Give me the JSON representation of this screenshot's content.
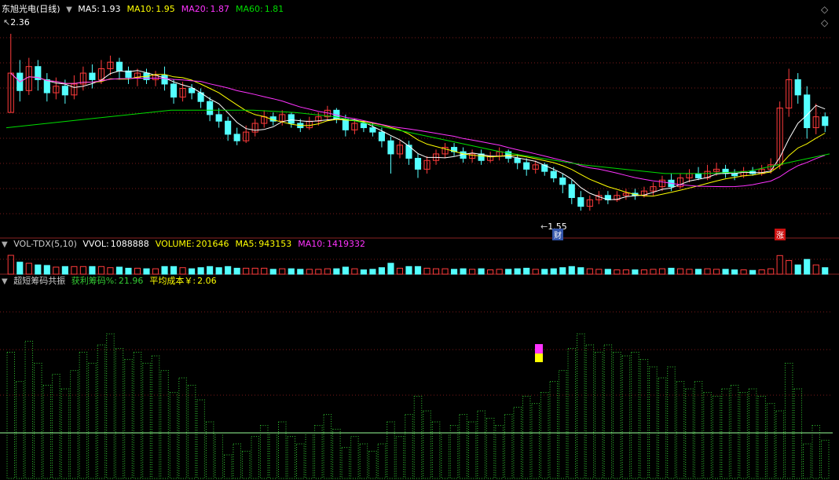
{
  "colors": {
    "up": "#ff3b3b",
    "down": "#54ffff",
    "ma5": "#ffffff",
    "ma10": "#ffff00",
    "ma20": "#ff33ff",
    "ma60": "#00dd00",
    "grid": "#7a1a1a",
    "chip": "#33cc33",
    "chip_light": "#99ff99"
  },
  "price_panel": {
    "title": "东旭光电(日线)",
    "indicators": [
      {
        "label": "MA5:",
        "value": "1.93",
        "color": "#ffffff"
      },
      {
        "label": "MA10:",
        "value": "1.95",
        "color": "#ffff00"
      },
      {
        "label": "MA20:",
        "value": "1.87",
        "color": "#ff33ff"
      },
      {
        "label": "MA60:",
        "value": "1.81",
        "color": "#00dd00"
      }
    ],
    "high_label": "2.36",
    "low_label": "1.55",
    "badge_cai": "财",
    "badge_zhang": "涨"
  },
  "volume_panel": {
    "title": "VOL-TDX(5,10)",
    "indicators": [
      {
        "label": "VVOL:",
        "value": "1088888",
        "color": "#ffffff"
      },
      {
        "label": "VOLUME:",
        "value": "201646",
        "color": "#ffff00"
      },
      {
        "label": "MA5:",
        "value": "943153",
        "color": "#ffff00"
      },
      {
        "label": "MA10:",
        "value": "1419332",
        "color": "#ff33ff"
      }
    ]
  },
  "chip_panel": {
    "title": "超短筹码共振",
    "indicators": [
      {
        "label": "获利筹码%:",
        "value": "21.96",
        "color": "#33cc33"
      },
      {
        "label": "平均成本￥:",
        "value": "2.06",
        "color": "#ffff00"
      }
    ]
  },
  "chart_data": {
    "type": "candlestick",
    "price_range": [
      1.45,
      2.45
    ],
    "candles": [
      [
        2.0,
        2.18,
        2.0,
        2.36
      ],
      [
        2.18,
        2.1,
        2.05,
        2.24
      ],
      [
        2.1,
        2.21,
        2.08,
        2.25
      ],
      [
        2.21,
        2.15,
        2.1,
        2.24
      ],
      [
        2.15,
        2.09,
        2.05,
        2.18
      ],
      [
        2.09,
        2.12,
        2.06,
        2.16
      ],
      [
        2.12,
        2.08,
        2.04,
        2.15
      ],
      [
        2.08,
        2.13,
        2.06,
        2.17
      ],
      [
        2.13,
        2.18,
        2.1,
        2.21
      ],
      [
        2.18,
        2.15,
        2.11,
        2.22
      ],
      [
        2.15,
        2.2,
        2.13,
        2.24
      ],
      [
        2.2,
        2.23,
        2.17,
        2.26
      ],
      [
        2.23,
        2.19,
        2.15,
        2.25
      ],
      [
        2.19,
        2.16,
        2.13,
        2.21
      ],
      [
        2.16,
        2.18,
        2.12,
        2.2
      ],
      [
        2.18,
        2.15,
        2.13,
        2.2
      ],
      [
        2.15,
        2.17,
        2.12,
        2.19
      ],
      [
        2.17,
        2.13,
        2.1,
        2.21
      ],
      [
        2.13,
        2.07,
        2.04,
        2.15
      ],
      [
        2.07,
        2.11,
        2.05,
        2.14
      ],
      [
        2.11,
        2.09,
        2.06,
        2.13
      ],
      [
        2.09,
        2.05,
        2.02,
        2.11
      ],
      [
        2.05,
        1.99,
        1.96,
        2.07
      ],
      [
        1.99,
        1.96,
        1.93,
        2.02
      ],
      [
        1.96,
        1.9,
        1.87,
        1.98
      ],
      [
        1.9,
        1.87,
        1.85,
        1.93
      ],
      [
        1.87,
        1.91,
        1.86,
        1.94
      ],
      [
        1.91,
        1.95,
        1.89,
        1.97
      ],
      [
        1.95,
        1.98,
        1.93,
        2.01
      ],
      [
        1.98,
        1.96,
        1.94,
        2.0
      ],
      [
        1.96,
        1.99,
        1.94,
        2.01
      ],
      [
        1.99,
        1.95,
        1.93,
        2.0
      ],
      [
        1.95,
        1.93,
        1.91,
        1.97
      ],
      [
        1.93,
        1.96,
        1.92,
        1.98
      ],
      [
        1.96,
        1.98,
        1.94,
        2.0
      ],
      [
        1.98,
        2.01,
        1.96,
        2.03
      ],
      [
        2.01,
        1.97,
        1.95,
        2.02
      ],
      [
        1.97,
        1.92,
        1.89,
        1.99
      ],
      [
        1.92,
        1.95,
        1.9,
        1.97
      ],
      [
        1.95,
        1.93,
        1.91,
        1.96
      ],
      [
        1.93,
        1.91,
        1.89,
        1.95
      ],
      [
        1.91,
        1.87,
        1.84,
        1.93
      ],
      [
        1.87,
        1.81,
        1.72,
        1.89
      ],
      [
        1.81,
        1.85,
        1.79,
        1.87
      ],
      [
        1.85,
        1.79,
        1.76,
        1.87
      ],
      [
        1.79,
        1.74,
        1.7,
        1.81
      ],
      [
        1.74,
        1.78,
        1.72,
        1.8
      ],
      [
        1.78,
        1.81,
        1.76,
        1.83
      ],
      [
        1.81,
        1.84,
        1.79,
        1.86
      ],
      [
        1.84,
        1.82,
        1.8,
        1.86
      ],
      [
        1.82,
        1.79,
        1.77,
        1.84
      ],
      [
        1.79,
        1.81,
        1.77,
        1.83
      ],
      [
        1.81,
        1.78,
        1.76,
        1.83
      ],
      [
        1.78,
        1.8,
        1.77,
        1.82
      ],
      [
        1.8,
        1.82,
        1.78,
        1.84
      ],
      [
        1.82,
        1.79,
        1.77,
        1.83
      ],
      [
        1.79,
        1.77,
        1.74,
        1.81
      ],
      [
        1.77,
        1.74,
        1.71,
        1.79
      ],
      [
        1.74,
        1.76,
        1.72,
        1.78
      ],
      [
        1.76,
        1.73,
        1.71,
        1.77
      ],
      [
        1.73,
        1.7,
        1.68,
        1.75
      ],
      [
        1.7,
        1.67,
        1.63,
        1.72
      ],
      [
        1.67,
        1.61,
        1.58,
        1.69
      ],
      [
        1.61,
        1.57,
        1.55,
        1.64
      ],
      [
        1.57,
        1.6,
        1.55,
        1.62
      ],
      [
        1.6,
        1.62,
        1.58,
        1.64
      ],
      [
        1.62,
        1.6,
        1.58,
        1.64
      ],
      [
        1.6,
        1.62,
        1.59,
        1.64
      ],
      [
        1.62,
        1.63,
        1.6,
        1.65
      ],
      [
        1.63,
        1.62,
        1.6,
        1.65
      ],
      [
        1.62,
        1.64,
        1.61,
        1.66
      ],
      [
        1.64,
        1.66,
        1.62,
        1.68
      ],
      [
        1.66,
        1.69,
        1.64,
        1.71
      ],
      [
        1.69,
        1.66,
        1.64,
        1.72
      ],
      [
        1.66,
        1.7,
        1.65,
        1.72
      ],
      [
        1.7,
        1.72,
        1.68,
        1.74
      ],
      [
        1.72,
        1.7,
        1.69,
        1.75
      ],
      [
        1.7,
        1.73,
        1.69,
        1.76
      ],
      [
        1.73,
        1.74,
        1.71,
        1.77
      ],
      [
        1.74,
        1.72,
        1.7,
        1.76
      ],
      [
        1.72,
        1.71,
        1.69,
        1.74
      ],
      [
        1.71,
        1.73,
        1.7,
        1.75
      ],
      [
        1.73,
        1.72,
        1.71,
        1.75
      ],
      [
        1.72,
        1.74,
        1.71,
        1.76
      ],
      [
        1.74,
        1.76,
        1.72,
        1.79
      ],
      [
        1.76,
        2.02,
        1.74,
        2.05
      ],
      [
        2.02,
        2.15,
        1.98,
        2.2
      ],
      [
        2.15,
        2.08,
        2.04,
        2.18
      ],
      [
        2.08,
        1.93,
        1.88,
        2.12
      ],
      [
        1.93,
        1.98,
        1.9,
        2.04
      ],
      [
        1.98,
        1.94,
        1.91,
        2.0
      ]
    ],
    "ma60_values": [
      1.93,
      1.95,
      1.97,
      1.99,
      2.01,
      2.01,
      2.01,
      2.0,
      1.98,
      1.94,
      1.9,
      1.86,
      1.82,
      1.79,
      1.76,
      1.74,
      1.72,
      1.72,
      1.73,
      1.77,
      1.81
    ]
  }
}
